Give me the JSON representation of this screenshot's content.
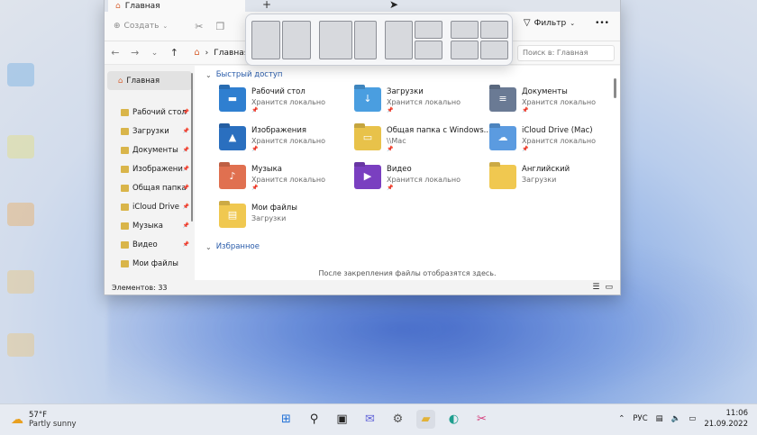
{
  "window": {
    "tab_title": "Главная",
    "tab_add": "+",
    "commands": {
      "create_label": "Создать",
      "filter_label": "Фильтр",
      "more_label": "•••"
    },
    "address": {
      "crumb": "Главная",
      "search_placeholder": "Поиск в: Главная"
    },
    "sidebar": {
      "home": "Главная",
      "items": [
        {
          "label": "Рабочий стол",
          "icon": "desktop-icon",
          "pinned": true
        },
        {
          "label": "Загрузки",
          "icon": "downloads-icon",
          "pinned": true
        },
        {
          "label": "Документы",
          "icon": "documents-icon",
          "pinned": true
        },
        {
          "label": "Изображени",
          "icon": "pictures-icon",
          "pinned": true
        },
        {
          "label": "Общая папка",
          "icon": "folder-icon",
          "pinned": true
        },
        {
          "label": "iCloud Drive",
          "icon": "icloud-icon",
          "pinned": true
        },
        {
          "label": "Музыка",
          "icon": "music-icon",
          "pinned": true
        },
        {
          "label": "Видео",
          "icon": "video-icon",
          "pinned": true
        },
        {
          "label": "Мои файлы",
          "icon": "folder-icon",
          "pinned": false
        }
      ]
    },
    "quick_access": {
      "heading": "Быстрый доступ",
      "items": [
        {
          "name": "Рабочий стол",
          "sub": "Хранится локально",
          "icon": "desktop-folder-icon",
          "color": "#2f7fd0",
          "glyph": "▬"
        },
        {
          "name": "Загрузки",
          "sub": "Хранится локально",
          "icon": "downloads-folder-icon",
          "color": "#4a9ee0",
          "glyph": "↓"
        },
        {
          "name": "Документы",
          "sub": "Хранится локально",
          "icon": "documents-folder-icon",
          "color": "#6a7a94",
          "glyph": "≡"
        },
        {
          "name": "Изображения",
          "sub": "Хранится локально",
          "icon": "pictures-folder-icon",
          "color": "#2a6fbf",
          "glyph": "▲"
        },
        {
          "name": "Общая папка с Windows...",
          "sub": "\\\\Mac",
          "icon": "shared-folder-icon",
          "color": "#e8c24a",
          "glyph": "▭"
        },
        {
          "name": "iCloud Drive (Mac)",
          "sub": "Хранится локально",
          "icon": "icloud-folder-icon",
          "color": "#5b9be0",
          "glyph": "☁"
        },
        {
          "name": "Музыка",
          "sub": "Хранится локально",
          "icon": "music-folder-icon",
          "color": "#e07050",
          "glyph": "♪"
        },
        {
          "name": "Видео",
          "sub": "Хранится локально",
          "icon": "video-folder-icon",
          "color": "#7a3fc0",
          "glyph": "▶"
        },
        {
          "name": "Английский",
          "sub": "Загрузки",
          "icon": "folder-icon",
          "color": "#f0c850",
          "glyph": ""
        },
        {
          "name": "Мои файлы",
          "sub": "Загрузки",
          "icon": "myfiles-folder-icon",
          "color": "#f0c850",
          "glyph": "▤"
        }
      ]
    },
    "favorites": {
      "heading": "Избранное",
      "empty_message": "После закрепления файлы отобразятся здесь."
    },
    "status": {
      "items_count": "Элементов: 33"
    }
  },
  "taskbar": {
    "weather_temp": "57°F",
    "weather_desc": "Partly sunny",
    "language": "РУС",
    "time": "11:06",
    "date": "21.09.2022"
  }
}
